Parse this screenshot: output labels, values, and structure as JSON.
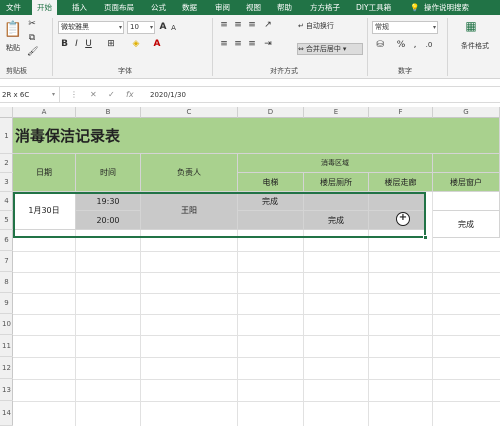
{
  "tabs": [
    {
      "label": "文件"
    },
    {
      "label": "开始"
    },
    {
      "label": "插入"
    },
    {
      "label": "页面布局"
    },
    {
      "label": "公式"
    },
    {
      "label": "数据"
    },
    {
      "label": "审阅"
    },
    {
      "label": "视图"
    },
    {
      "label": "帮助"
    },
    {
      "label": "方方格子"
    },
    {
      "label": "DIY工具箱"
    }
  ],
  "search_label": "操作说明搜索",
  "ribbon": {
    "paste_label": "粘贴",
    "clipboard_label": "剪贴板",
    "font_name": "微软雅黑",
    "font_size": "10",
    "font_group_label": "字体",
    "wrap_text_label": "自动换行",
    "merge_center_label": "合并后居中",
    "alignment_group_label": "对齐方式",
    "number_format": "常规",
    "number_group_label": "数字",
    "conditional_format_label": "条件格式"
  },
  "formula_bar": {
    "name_box": "2R x 6C",
    "content": "2020/1/30"
  },
  "columns": [
    "A",
    "B",
    "C",
    "D",
    "E",
    "F",
    "G"
  ],
  "rows": [
    "1",
    "2",
    "3",
    "4",
    "5",
    "6",
    "7",
    "8",
    "9",
    "10",
    "11",
    "12",
    "13",
    "14"
  ],
  "sheet": {
    "title": "消毒保洁记录表",
    "header_date": "日期",
    "header_time": "时间",
    "header_person": "负责人",
    "header_area": "消毒区域",
    "area_cols": [
      "电梯",
      "楼层厕所",
      "楼层走廊",
      "楼层窗户"
    ],
    "date_value": "1月30日",
    "time_1": "19:30",
    "time_2": "20:00",
    "person_value": "王阳",
    "d4": "完成",
    "e5": "完成",
    "g5": "完成"
  },
  "colors": {
    "green": "#a9d18e",
    "gray": "#c9c9c9",
    "excel_green": "#217346"
  }
}
